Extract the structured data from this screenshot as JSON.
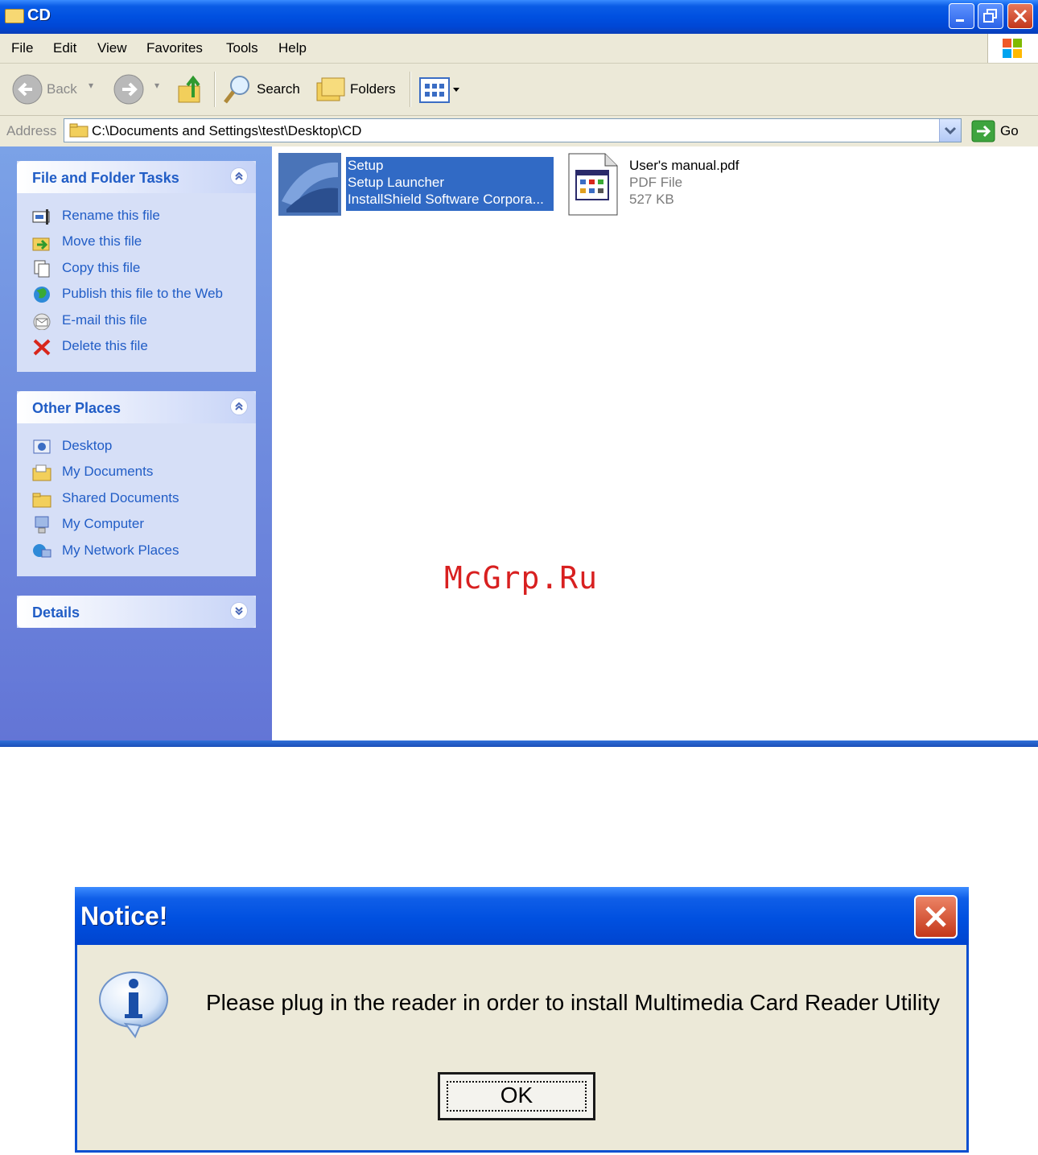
{
  "window": {
    "title": "CD"
  },
  "menu": {
    "items": [
      "File",
      "Edit",
      "View",
      "Favorites",
      "Tools",
      "Help"
    ]
  },
  "toolbar": {
    "back_label": "Back",
    "search_label": "Search",
    "folders_label": "Folders"
  },
  "address": {
    "label": "Address",
    "value": "C:\\Documents and Settings\\test\\Desktop\\CD",
    "go_label": "Go"
  },
  "tasks": {
    "title": "File and Folder Tasks",
    "items": [
      {
        "label": "Rename this file",
        "icon": "rename-icon"
      },
      {
        "label": "Move this file",
        "icon": "move-icon"
      },
      {
        "label": "Copy this file",
        "icon": "copy-icon"
      },
      {
        "label": "Publish this file to the Web",
        "icon": "globe-icon"
      },
      {
        "label": "E-mail this file",
        "icon": "email-icon"
      },
      {
        "label": "Delete this file",
        "icon": "delete-icon"
      }
    ]
  },
  "places": {
    "title": "Other Places",
    "items": [
      {
        "label": "Desktop",
        "icon": "desktop-icon"
      },
      {
        "label": "My Documents",
        "icon": "folder-icon"
      },
      {
        "label": "Shared Documents",
        "icon": "folder-icon"
      },
      {
        "label": "My Computer",
        "icon": "computer-icon"
      },
      {
        "label": "My Network Places",
        "icon": "network-icon"
      }
    ]
  },
  "details": {
    "title": "Details"
  },
  "files": [
    {
      "name": "Setup",
      "type": "Setup Launcher",
      "company": "InstallShield Software Corpora...",
      "selected": true
    },
    {
      "name": "User's manual.pdf",
      "type": "PDF File",
      "size": "527 KB",
      "selected": false
    }
  ],
  "watermark": "McGrp.Ru",
  "dialog": {
    "title": "Notice!",
    "message": "Please plug in the reader in order to install Multimedia Card Reader Utility",
    "ok_label": "OK",
    "icon": "info-icon"
  },
  "colors": {
    "titlebar_blue": "#0050e0",
    "selection_blue": "#316ac5",
    "task_link": "#215dc6",
    "watermark_red": "#d82020"
  }
}
